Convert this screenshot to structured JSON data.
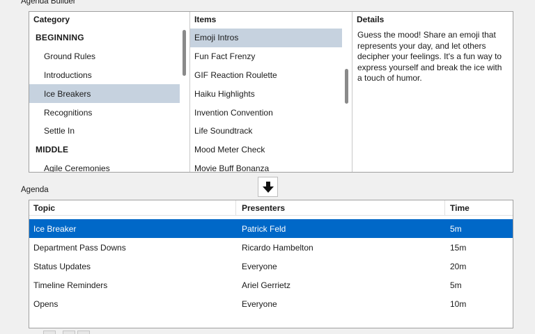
{
  "builder": {
    "title": "Agenda Builder",
    "category_header": "Category",
    "items_header": "Items",
    "details_header": "Details",
    "categories": [
      {
        "label": "BEGINNING",
        "kind": "head"
      },
      {
        "label": "Ground Rules",
        "kind": "sub"
      },
      {
        "label": "Introductions",
        "kind": "sub"
      },
      {
        "label": "Ice Breakers",
        "kind": "sub",
        "selected": true
      },
      {
        "label": "Recognitions",
        "kind": "sub"
      },
      {
        "label": "Settle In",
        "kind": "sub"
      },
      {
        "label": "MIDDLE",
        "kind": "head"
      },
      {
        "label": "Agile Ceremonies",
        "kind": "sub"
      }
    ],
    "items": [
      {
        "label": "Emoji Intros",
        "selected": true
      },
      {
        "label": "Fun Fact Frenzy"
      },
      {
        "label": "GIF Reaction Roulette"
      },
      {
        "label": "Haiku Highlights"
      },
      {
        "label": "Invention Convention"
      },
      {
        "label": "Life Soundtrack"
      },
      {
        "label": "Mood Meter Check"
      },
      {
        "label": "Movie Buff Bonanza"
      }
    ],
    "details_text": "Guess the mood! Share an emoji that represents your day, and let others decipher your feelings. It's a fun way to express yourself and break the ice with a touch of humor."
  },
  "add_button_icon": "arrow-down-icon",
  "agenda": {
    "title": "Agenda",
    "columns": [
      "Topic",
      "Presenters",
      "Time"
    ],
    "rows": [
      {
        "topic": "Ice Breaker",
        "presenters": "Patrick Feld",
        "time": "5m",
        "selected": true
      },
      {
        "topic": "Department Pass Downs",
        "presenters": "Ricardo Hambelton",
        "time": "15m"
      },
      {
        "topic": "Status Updates",
        "presenters": "Everyone",
        "time": "20m"
      },
      {
        "topic": "Timeline Reminders",
        "presenters": "Ariel Gerrietz",
        "time": "5m"
      },
      {
        "topic": "Opens",
        "presenters": "Everyone",
        "time": "10m"
      }
    ]
  },
  "colors": {
    "selection_list": "#c6d2df",
    "selection_table": "#0068c8"
  }
}
